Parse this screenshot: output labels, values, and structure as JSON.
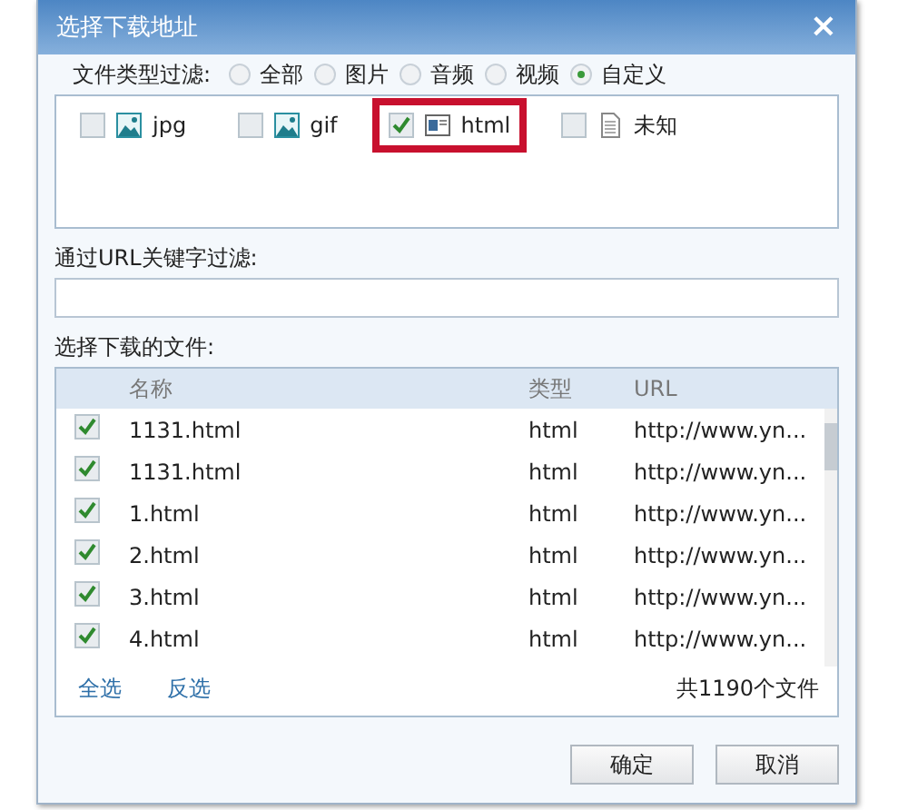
{
  "window": {
    "title": "选择下载地址",
    "close": "×"
  },
  "type_filter": {
    "label": "文件类型过滤:",
    "options": [
      {
        "label": "全部",
        "selected": false
      },
      {
        "label": "图片",
        "selected": false
      },
      {
        "label": "音频",
        "selected": false
      },
      {
        "label": "视频",
        "selected": false
      },
      {
        "label": "自定义",
        "selected": true
      }
    ]
  },
  "file_types": [
    {
      "label": "jpg",
      "kind": "image",
      "checked": false,
      "highlighted": false
    },
    {
      "label": "gif",
      "kind": "image",
      "checked": false,
      "highlighted": false
    },
    {
      "label": "html",
      "kind": "web",
      "checked": true,
      "highlighted": true
    },
    {
      "label": "未知",
      "kind": "document",
      "checked": false,
      "highlighted": false
    }
  ],
  "url_filter": {
    "label": "通过URL关键字过滤:"
  },
  "files_label": "选择下载的文件:",
  "table": {
    "columns": [
      "名称",
      "类型",
      "URL"
    ],
    "rows": [
      {
        "name": "1131.html",
        "type": "html",
        "url": "http://www.yn...",
        "checked": true
      },
      {
        "name": "1131.html",
        "type": "html",
        "url": "http://www.yn...",
        "checked": true
      },
      {
        "name": "1.html",
        "type": "html",
        "url": "http://www.yn...",
        "checked": true
      },
      {
        "name": "2.html",
        "type": "html",
        "url": "http://www.yn...",
        "checked": true
      },
      {
        "name": "3.html",
        "type": "html",
        "url": "http://www.yn...",
        "checked": true
      },
      {
        "name": "4.html",
        "type": "html",
        "url": "http://www.yn...",
        "checked": true
      }
    ]
  },
  "footer": {
    "links": [
      "全选",
      "反选"
    ],
    "count": "共1190个文件"
  },
  "buttons": [
    "确定",
    "取消"
  ]
}
